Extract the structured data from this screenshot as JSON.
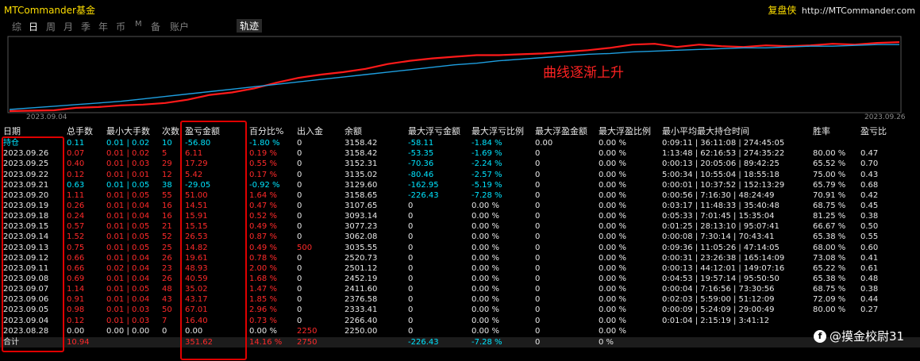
{
  "window": {
    "title": "MTCommander基金",
    "site_brand": "复盘侠",
    "site_url": "http://MTCommander.com"
  },
  "tabs": [
    {
      "label": "综"
    },
    {
      "label": "日"
    },
    {
      "label": "周"
    },
    {
      "label": "月"
    },
    {
      "label": "季"
    },
    {
      "label": "年"
    },
    {
      "label": "币"
    },
    {
      "label": "M"
    },
    {
      "label": "备"
    },
    {
      "label": "账户"
    }
  ],
  "active_tab": "日",
  "path_tab": "轨迹",
  "annotation": "曲线逐渐上升",
  "watermark": "@摸金校尉31",
  "colors": {
    "positive": "#ff2a2a",
    "negative": "#00e5ff",
    "equity_line": "#ff1a1a",
    "trend_line": "#1e9fe0",
    "highlight_box": "#e00000"
  },
  "chart_data": {
    "type": "line",
    "x_start_label": "2023.09.04",
    "x_end_label": "2023.09.26",
    "series": [
      {
        "color": "#ff1a1a",
        "values": [
          0.0,
          0.05,
          0.1,
          0.4,
          0.5,
          0.7,
          0.8,
          1.0,
          1.4,
          2.0,
          2.3,
          2.8,
          3.5,
          4.1,
          4.5,
          4.8,
          5.2,
          5.8,
          6.2,
          6.5,
          6.7,
          6.9,
          6.9,
          7.0,
          7.1,
          7.3,
          7.5,
          7.8,
          8.2,
          8.3,
          7.9,
          8.2,
          8.0,
          7.9,
          8.1,
          8.0,
          8.1,
          8.3,
          8.2,
          8.4,
          8.5
        ]
      },
      {
        "color": "#1e9fe0",
        "values": [
          0.2,
          0.4,
          0.6,
          0.8,
          1.0,
          1.2,
          1.5,
          1.8,
          2.1,
          2.4,
          2.7,
          3.0,
          3.3,
          3.6,
          3.9,
          4.2,
          4.5,
          4.8,
          5.1,
          5.4,
          5.7,
          5.9,
          6.2,
          6.4,
          6.6,
          6.8,
          7.0,
          7.1,
          7.3,
          7.4,
          7.5,
          7.6,
          7.7,
          7.8,
          7.8,
          7.9,
          8.0,
          8.0,
          8.1,
          8.2,
          8.2
        ]
      }
    ],
    "ylim": [
      0,
      9
    ]
  },
  "table": {
    "headers": [
      "日期",
      "总手数",
      "最小大手数",
      "次数",
      "盈亏金额",
      "百分比%",
      "出入金",
      "余额",
      "最大浮亏金额",
      "最大浮亏比例",
      "最大浮盈金额",
      "最大浮盈比例",
      "最小平均最大持仓时间",
      "胜率",
      "盈亏比"
    ],
    "rows": [
      {
        "date": "持仓",
        "lots": "0.11",
        "minmax": "0.01 | 0.02",
        "count": "10",
        "pnl": "-56.80",
        "pct": "-1.80 %",
        "flow": "0",
        "balance": "3158.42",
        "maxloss": "-58.11",
        "maxloss_pct": "-1.84 %",
        "maxprofit": "0.00",
        "maxprofit_pct": "0.00 %",
        "hold": "0:09:11 | 36:11:08 | 274:45:05",
        "winrate": "",
        "pf": "",
        "tone": "cyan"
      },
      {
        "date": "2023.09.26",
        "lots": "0.07",
        "minmax": "0.01 | 0.02",
        "count": "5",
        "pnl": "6.11",
        "pct": "0.19 %",
        "flow": "0",
        "balance": "3158.42",
        "maxloss": "-53.35",
        "maxloss_pct": "-1.69 %",
        "maxprofit": "0",
        "maxprofit_pct": "0.00 %",
        "hold": "1:13:48 | 62:16:53 | 274:35:22",
        "winrate": "80.00 %",
        "pf": "0.47",
        "tone": "red"
      },
      {
        "date": "2023.09.25",
        "lots": "0.40",
        "minmax": "0.01 | 0.03",
        "count": "29",
        "pnl": "17.29",
        "pct": "0.55 %",
        "flow": "0",
        "balance": "3152.31",
        "maxloss": "-70.36",
        "maxloss_pct": "-2.24 %",
        "maxprofit": "0",
        "maxprofit_pct": "0.00 %",
        "hold": "0:00:13 | 20:05:06 | 89:42:25",
        "winrate": "65.52 %",
        "pf": "0.70",
        "tone": "red"
      },
      {
        "date": "2023.09.22",
        "lots": "0.12",
        "minmax": "0.01 | 0.01",
        "count": "12",
        "pnl": "5.42",
        "pct": "0.17 %",
        "flow": "0",
        "balance": "3135.02",
        "maxloss": "-80.46",
        "maxloss_pct": "-2.57 %",
        "maxprofit": "0",
        "maxprofit_pct": "0.00 %",
        "hold": "5:00:34 | 10:55:04 | 18:55:18",
        "winrate": "75.00 %",
        "pf": "0.43",
        "tone": "red"
      },
      {
        "date": "2023.09.21",
        "lots": "0.63",
        "minmax": "0.01 | 0.05",
        "count": "38",
        "pnl": "-29.05",
        "pct": "-0.92 %",
        "flow": "0",
        "balance": "3129.60",
        "maxloss": "-162.95",
        "maxloss_pct": "-5.19 %",
        "maxprofit": "0",
        "maxprofit_pct": "0.00 %",
        "hold": "0:00:01 | 10:37:52 | 152:13:29",
        "winrate": "65.79 %",
        "pf": "0.68",
        "tone": "cyan"
      },
      {
        "date": "2023.09.20",
        "lots": "1.11",
        "minmax": "0.01 | 0.05",
        "count": "55",
        "pnl": "51.00",
        "pct": "1.64 %",
        "flow": "0",
        "balance": "3158.65",
        "maxloss": "-226.43",
        "maxloss_pct": "-7.28 %",
        "maxprofit": "0",
        "maxprofit_pct": "0.00 %",
        "hold": "0:00:56 | 7:16:30 | 48:24:49",
        "winrate": "70.91 %",
        "pf": "0.42",
        "tone": "red"
      },
      {
        "date": "2023.09.19",
        "lots": "0.26",
        "minmax": "0.01 | 0.04",
        "count": "16",
        "pnl": "14.51",
        "pct": "0.47 %",
        "flow": "0",
        "balance": "3107.65",
        "maxloss": "0",
        "maxloss_pct": "0.00 %",
        "maxprofit": "0",
        "maxprofit_pct": "0.00 %",
        "hold": "0:03:17 | 11:48:33 | 35:40:48",
        "winrate": "68.75 %",
        "pf": "0.45",
        "tone": "red"
      },
      {
        "date": "2023.09.18",
        "lots": "0.24",
        "minmax": "0.01 | 0.04",
        "count": "16",
        "pnl": "15.91",
        "pct": "0.52 %",
        "flow": "0",
        "balance": "3093.14",
        "maxloss": "0",
        "maxloss_pct": "0.00 %",
        "maxprofit": "0",
        "maxprofit_pct": "0.00 %",
        "hold": "0:05:33 | 7:01:45 | 15:35:04",
        "winrate": "81.25 %",
        "pf": "0.38",
        "tone": "red"
      },
      {
        "date": "2023.09.15",
        "lots": "0.57",
        "minmax": "0.01 | 0.05",
        "count": "21",
        "pnl": "15.15",
        "pct": "0.49 %",
        "flow": "0",
        "balance": "3077.23",
        "maxloss": "0",
        "maxloss_pct": "0.00 %",
        "maxprofit": "0",
        "maxprofit_pct": "0.00 %",
        "hold": "0:01:25 | 28:13:10 | 95:07:41",
        "winrate": "66.67 %",
        "pf": "0.50",
        "tone": "red"
      },
      {
        "date": "2023.09.14",
        "lots": "1.52",
        "minmax": "0.01 | 0.05",
        "count": "52",
        "pnl": "26.53",
        "pct": "0.87 %",
        "flow": "0",
        "balance": "3062.08",
        "maxloss": "0",
        "maxloss_pct": "0.00 %",
        "maxprofit": "0",
        "maxprofit_pct": "0.00 %",
        "hold": "0:00:08 | 7:30:14 | 70:43:41",
        "winrate": "65.38 %",
        "pf": "0.55",
        "tone": "red"
      },
      {
        "date": "2023.09.13",
        "lots": "0.75",
        "minmax": "0.01 | 0.05",
        "count": "25",
        "pnl": "14.82",
        "pct": "0.49 %",
        "flow": "500",
        "balance": "3035.55",
        "maxloss": "0",
        "maxloss_pct": "0.00 %",
        "maxprofit": "0",
        "maxprofit_pct": "0.00 %",
        "hold": "0:09:36 | 11:05:26 | 47:14:05",
        "winrate": "68.00 %",
        "pf": "0.60",
        "tone": "red",
        "flow_tone": "red"
      },
      {
        "date": "2023.09.12",
        "lots": "0.66",
        "minmax": "0.01 | 0.04",
        "count": "26",
        "pnl": "19.61",
        "pct": "0.78 %",
        "flow": "0",
        "balance": "2520.73",
        "maxloss": "0",
        "maxloss_pct": "0.00 %",
        "maxprofit": "0",
        "maxprofit_pct": "0.00 %",
        "hold": "0:00:31 | 23:26:38 | 165:14:09",
        "winrate": "73.08 %",
        "pf": "0.41",
        "tone": "red"
      },
      {
        "date": "2023.09.11",
        "lots": "0.66",
        "minmax": "0.02 | 0.04",
        "count": "23",
        "pnl": "48.93",
        "pct": "2.00 %",
        "flow": "0",
        "balance": "2501.12",
        "maxloss": "0",
        "maxloss_pct": "0.00 %",
        "maxprofit": "0",
        "maxprofit_pct": "0.00 %",
        "hold": "0:00:13 | 44:12:01 | 149:07:16",
        "winrate": "65.22 %",
        "pf": "0.61",
        "tone": "red"
      },
      {
        "date": "2023.09.08",
        "lots": "0.69",
        "minmax": "0.01 | 0.04",
        "count": "26",
        "pnl": "40.59",
        "pct": "1.68 %",
        "flow": "0",
        "balance": "2452.19",
        "maxloss": "0",
        "maxloss_pct": "0.00 %",
        "maxprofit": "0",
        "maxprofit_pct": "0.00 %",
        "hold": "0:04:53 | 19:57:14 | 95:50:50",
        "winrate": "65.38 %",
        "pf": "0.48",
        "tone": "red"
      },
      {
        "date": "2023.09.07",
        "lots": "1.14",
        "minmax": "0.01 | 0.05",
        "count": "48",
        "pnl": "35.02",
        "pct": "1.47 %",
        "flow": "0",
        "balance": "2411.60",
        "maxloss": "0",
        "maxloss_pct": "0.00 %",
        "maxprofit": "0",
        "maxprofit_pct": "0.00 %",
        "hold": "0:00:04 | 7:16:56 | 73:30:56",
        "winrate": "68.75 %",
        "pf": "0.38",
        "tone": "red"
      },
      {
        "date": "2023.09.06",
        "lots": "0.91",
        "minmax": "0.01 | 0.04",
        "count": "43",
        "pnl": "43.17",
        "pct": "1.85 %",
        "flow": "0",
        "balance": "2376.58",
        "maxloss": "0",
        "maxloss_pct": "0.00 %",
        "maxprofit": "0",
        "maxprofit_pct": "0.00 %",
        "hold": "0:02:03 | 5:59:00 | 51:12:09",
        "winrate": "72.09 %",
        "pf": "0.44",
        "tone": "red"
      },
      {
        "date": "2023.09.05",
        "lots": "0.98",
        "minmax": "0.01 | 0.03",
        "count": "50",
        "pnl": "67.01",
        "pct": "2.96 %",
        "flow": "0",
        "balance": "2333.41",
        "maxloss": "0",
        "maxloss_pct": "0.00 %",
        "maxprofit": "0",
        "maxprofit_pct": "0.00 %",
        "hold": "0:00:09 | 5:24:09 | 29:00:49",
        "winrate": "80.00 %",
        "pf": "0.27",
        "tone": "red"
      },
      {
        "date": "2023.09.04",
        "lots": "0.12",
        "minmax": "0.01 | 0.03",
        "count": "7",
        "pnl": "16.40",
        "pct": "0.73 %",
        "flow": "0",
        "balance": "2266.40",
        "maxloss": "0",
        "maxloss_pct": "0.00 %",
        "maxprofit": "0",
        "maxprofit_pct": "0.00 %",
        "hold": "0:01:04 | 2:15:19 | 3:41:12",
        "winrate": "",
        "pf": "",
        "tone": "red"
      },
      {
        "date": "2023.08.28",
        "lots": "0.00",
        "minmax": "0.00 | 0.00",
        "count": "0",
        "pnl": "0.00",
        "pct": "0.00 %",
        "flow": "2250",
        "balance": "2250.00",
        "maxloss": "0",
        "maxloss_pct": "0.00 %",
        "maxprofit": "0",
        "maxprofit_pct": "0.00 %",
        "hold": "",
        "winrate": "",
        "pf": "",
        "tone": "white",
        "flow_tone": "red"
      }
    ],
    "total": {
      "date": "合计",
      "lots": "10.94",
      "pnl": "351.62",
      "pct": "14.16 %",
      "flow": "2750",
      "maxloss": "-226.43",
      "maxloss_pct": "-7.28 %",
      "maxprofit": "0",
      "maxprofit_pct": "0 %"
    }
  }
}
